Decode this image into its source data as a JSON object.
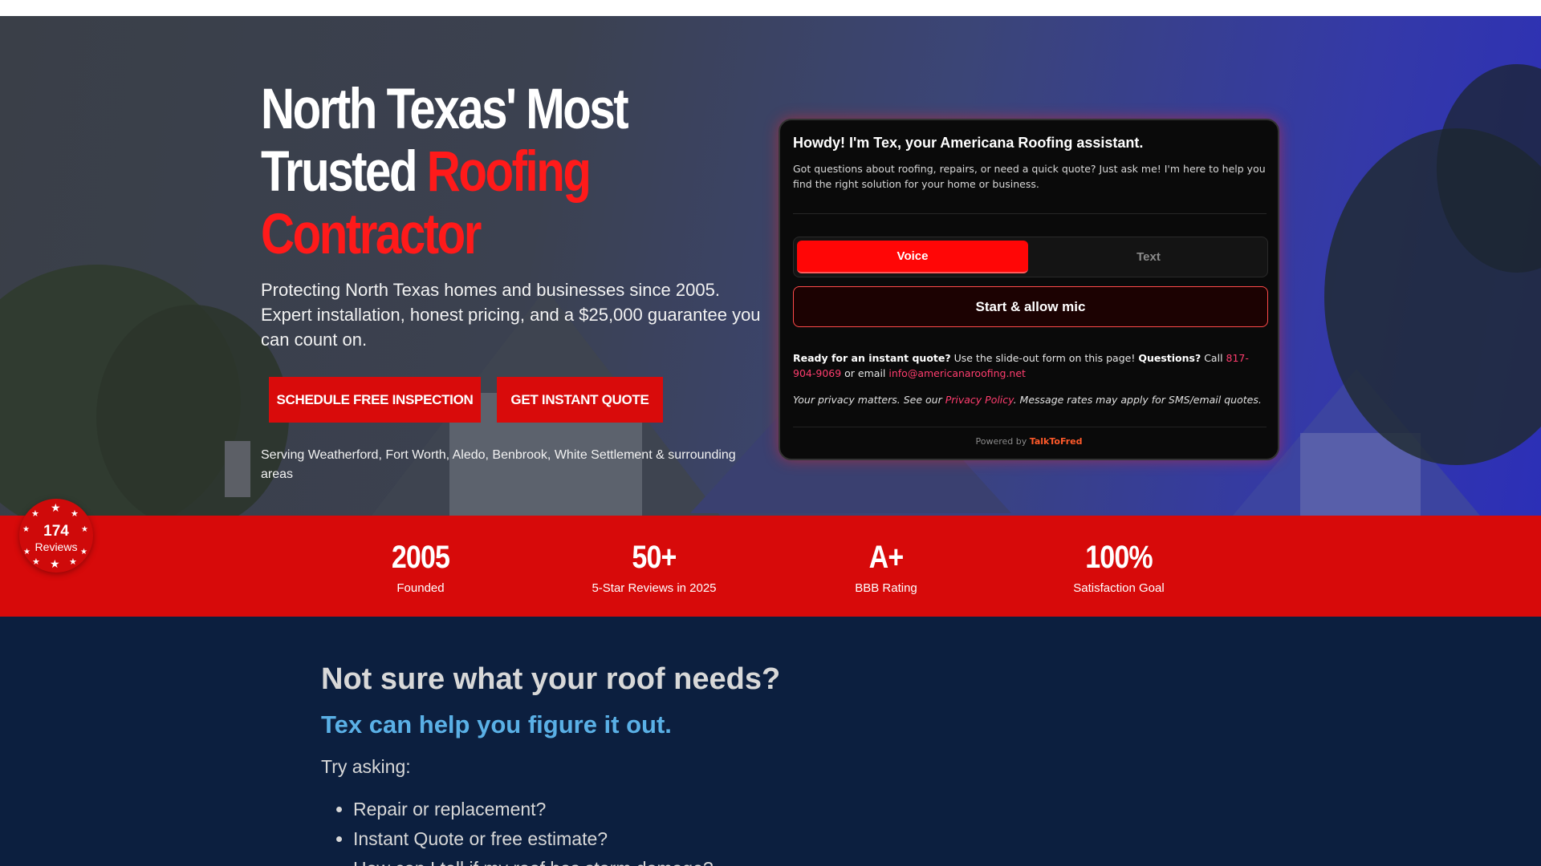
{
  "hero": {
    "headline_part1": "North Texas' Most Trusted ",
    "headline_highlight": "Roofing Contractor",
    "subtext": "Protecting North Texas homes and businesses since 2005. Expert installation, honest pricing, and a $25,000 guarantee you can count on.",
    "btn_schedule": "SCHEDULE FREE INSPECTION",
    "btn_quote": "GET INSTANT QUOTE",
    "serving": "Serving Weatherford, Fort Worth, Aledo, Benbrook, White Settlement & surrounding areas"
  },
  "chat": {
    "title": "Howdy! I'm Tex, your Americana Roofing assistant.",
    "intro": "Got questions about roofing, repairs, or need a quick quote? Just ask me! I'm here to help you find the right solution for your home or business.",
    "tab_voice": "Voice",
    "tab_text": "Text",
    "mic_button": "Start & allow mic",
    "ready_bold": "Ready for an instant quote?",
    "ready_text": " Use the slide-out form on this page! ",
    "questions_bold": "Questions?",
    "call_text": " Call ",
    "phone": "817-904-9069",
    "email_text": " or email ",
    "email": "info@americanaroofing.net",
    "privacy_pre": "Your privacy matters. See our ",
    "privacy_link": "Privacy Policy",
    "privacy_post": ". Message rates may apply for SMS/email quotes.",
    "powered_by": "Powered by ",
    "powered_brand": "TalkToFred"
  },
  "badge": {
    "count": "174",
    "label": "Reviews"
  },
  "stats": [
    {
      "value": "2005",
      "label": "Founded"
    },
    {
      "value": "50+",
      "label": "5-Star Reviews in 2025"
    },
    {
      "value": "A+",
      "label": "BBB Rating"
    },
    {
      "value": "100%",
      "label": "Satisfaction Goal"
    }
  ],
  "lower": {
    "heading": "Not sure what your roof needs?",
    "subheading": "Tex can help you figure it out.",
    "try_asking": "Try asking:",
    "questions": [
      "Repair or replacement?",
      "Instant Quote or free estimate?",
      "How can I tell if my roof has storm damage?"
    ]
  },
  "colors": {
    "brand_red": "#d70a0a",
    "accent_blue": "#5ab0e6",
    "navy": "#0c1f3f"
  }
}
